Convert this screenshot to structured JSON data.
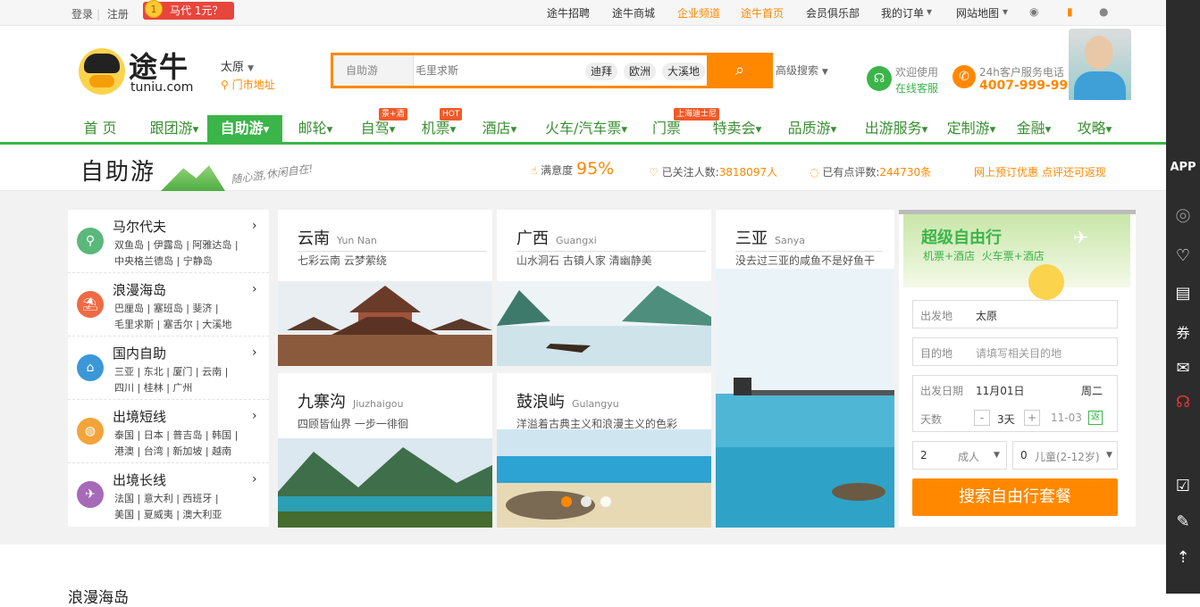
{
  "topbar": {
    "login": "登录",
    "register": "注册",
    "promo_coin": "1",
    "promo_text": "马代 1元？",
    "links": [
      "途牛招聘",
      "途牛商城",
      "企业频道",
      "途牛首页",
      "会员俱乐部",
      "我的订单",
      "网站地图"
    ],
    "link_colors": {
      "企业频道": "#ff8800",
      "途牛首页": "#ff8800"
    }
  },
  "header": {
    "logo_text": "途牛",
    "logo_domain": "tuniu.com",
    "city": "太原",
    "store": "门市地址",
    "search": {
      "category": "自助游",
      "placeholder": "毛里求斯",
      "hot_tags": [
        "迪拜",
        "欧洲",
        "大溪地"
      ],
      "button_icon": "search-icon"
    },
    "advanced_search": "高级搜索",
    "service_welcome": "欢迎使用",
    "service_online": "在线客服",
    "hotline_label": "24h客户服务电话",
    "hotline_number": "4007-999-999"
  },
  "nav": {
    "items": [
      {
        "label": "首 页"
      },
      {
        "label": "跟团游"
      },
      {
        "label": "自助游"
      },
      {
        "label": "邮轮"
      },
      {
        "label": "自驾"
      },
      {
        "label": "机票"
      },
      {
        "label": "酒店"
      },
      {
        "label": "火车/汽车票"
      },
      {
        "label": "门票"
      },
      {
        "label": "特卖会"
      },
      {
        "label": "品质游"
      },
      {
        "label": "出游服务"
      },
      {
        "label": "定制游"
      },
      {
        "label": "金融"
      },
      {
        "label": "攻略"
      }
    ],
    "tags": {
      "zijia": "景+酒",
      "jipiao": "HOT",
      "menpiao": "上海迪士尼"
    }
  },
  "band": {
    "title": "自助游",
    "slogan": "随心游,休闲自在!",
    "satisfaction_label": "满意度",
    "satisfaction_value": "95%",
    "followers_label": "已关注人数:",
    "followers_value": "3818097人",
    "reviews_label": "已有点评数:",
    "reviews_value": "244730条",
    "promo": "网上预订优惠 点评还可返现"
  },
  "destinations": [
    {
      "title": "马尔代夫",
      "rows": [
        "双鱼岛 | 伊露岛 | 阿雅达岛 |",
        "中央格兰德岛 | 宁静岛"
      ],
      "color": "#5ab87a"
    },
    {
      "title": "浪漫海岛",
      "rows": [
        "巴厘岛 | 塞班岛 | 斐济 |",
        "毛里求斯 | 塞舌尔 | 大溪地"
      ],
      "color": "#ef6b45"
    },
    {
      "title": "国内自助",
      "rows": [
        "三亚 | 东北 | 厦门 | 云南 |",
        "四川 | 桂林 | 广州"
      ],
      "color": "#3b97d8"
    },
    {
      "title": "出境短线",
      "rows": [
        "泰国 | 日本 | 普吉岛 | 韩国 |",
        "港澳 | 台湾 | 新加坡 | 越南"
      ],
      "color": "#f3a33a"
    },
    {
      "title": "出境长线",
      "rows": [
        "法国 | 意大利 | 西班牙 |",
        "美国 | 夏威夷 | 澳大利亚"
      ],
      "color": "#a66ab8"
    }
  ],
  "cards": [
    {
      "name": "云南",
      "en": "Yun Nan",
      "desc": "七彩云南 云梦萦绕"
    },
    {
      "name": "广西",
      "en": "Guangxi",
      "desc": "山水洞石 古镇人家 清幽静美"
    },
    {
      "name": "三亚",
      "en": "Sanya",
      "desc": "没去过三亚的咸鱼不是好鱼干"
    },
    {
      "name": "九寨沟",
      "en": "Jiuzhaigou",
      "desc": "四顾皆仙界 一步一徘徊"
    },
    {
      "name": "鼓浪屿",
      "en": "Gulangyu",
      "desc": "洋溢着古典主义和浪漫主义的色彩"
    }
  ],
  "panel": {
    "title": "超级自由行",
    "subtitle": "机票+酒店  火车票+酒店",
    "from_label": "出发地",
    "from_value": "太原",
    "to_label": "目的地",
    "to_placeholder": "请填写相关目的地",
    "date_label": "出发日期",
    "date_value": "11月01日",
    "weekday": "周二",
    "days_label": "天数",
    "minus": "-",
    "days_value": "3天",
    "plus": "+",
    "return_date": "11-03",
    "return_badge": "返",
    "adults_count": "2",
    "adults_label": "成人",
    "children_count": "0",
    "children_label": "儿童(2-12岁)",
    "button": "搜索自由行套餐"
  },
  "sidebar": {
    "app": "APP",
    "coupon": "券"
  },
  "section_title": "浪漫海岛"
}
